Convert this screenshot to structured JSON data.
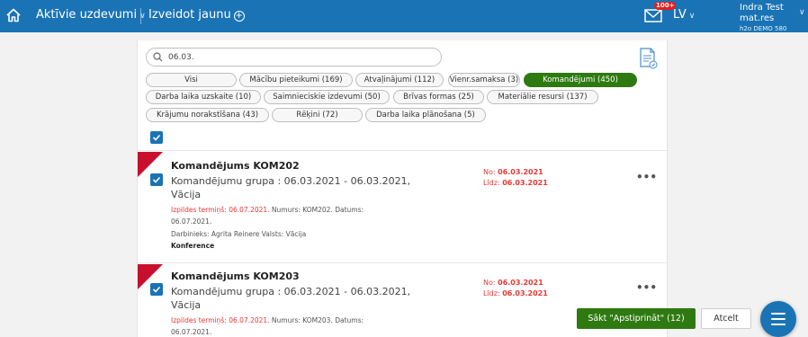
{
  "header": {
    "nav_active_tasks": "Aktīvie uzdevumi",
    "nav_create_new": "Izveidot jaunu",
    "mail_badge": "100+",
    "language": "LV",
    "user_name": "Indra Test mat.res",
    "user_sub": "h2o DEMO 580"
  },
  "search": {
    "value": "06.03."
  },
  "filters": [
    "Visi",
    "Mācību pieteikumi (169)",
    "Atvaļinājumi (112)",
    "Vienr.samaksa (3)",
    "Komandējumi (450)",
    "Darba laika uzskaite (10)",
    "Saimnieciskie izdevumi (50)",
    "Brīvas formas (25)",
    "Materiālie resursi (137)",
    "Krājumu norakstīšana (43)",
    "Rēķini (72)",
    "Darba laika plānošana (5)"
  ],
  "active_filter": "Komandējumi (450)",
  "items": [
    {
      "title": "Komandējums KOM202",
      "subtitle": "Komandējumu grupa : 06.03.2021 - 06.03.2021, Vācija",
      "due_label": "Izpildes termiņš: 06.07.2021.",
      "meta": " Numurs: KOM202. Datums: 06.07.2021.",
      "employee": "Darbinieks: Agrita Reinere Valsts: Vācija",
      "tag": "Konference",
      "from_label": "No:",
      "from_date": "06.03.2021",
      "to_label": "Līdz:",
      "to_date": "06.03.2021"
    },
    {
      "title": "Komandējums KOM203",
      "subtitle": "Komandējumu grupa : 06.03.2021 - 06.03.2021, Vācija",
      "due_label": "Izpildes termiņš: 06.07.2021.",
      "meta": " Numurs: KOM203. Datums: 06.07.2021.",
      "from_label": "No:",
      "from_date": "06.03.2021",
      "to_label": "Līdz:",
      "to_date": "06.03.2021"
    }
  ],
  "more_label": "•••",
  "actions": {
    "approve": "Sākt \"Apstiprināt\" (12)",
    "cancel": "Atcelt"
  },
  "colors": {
    "topbar": "#1a73b5",
    "accent_green": "#2e7a10",
    "flag_red": "#c8102e",
    "date_red": "#e53935"
  },
  "icons": [
    "home-icon",
    "plus-circle-icon",
    "mail-icon",
    "search-icon",
    "excel-export-icon",
    "checkmark-icon",
    "more-icon",
    "menu-icon"
  ]
}
